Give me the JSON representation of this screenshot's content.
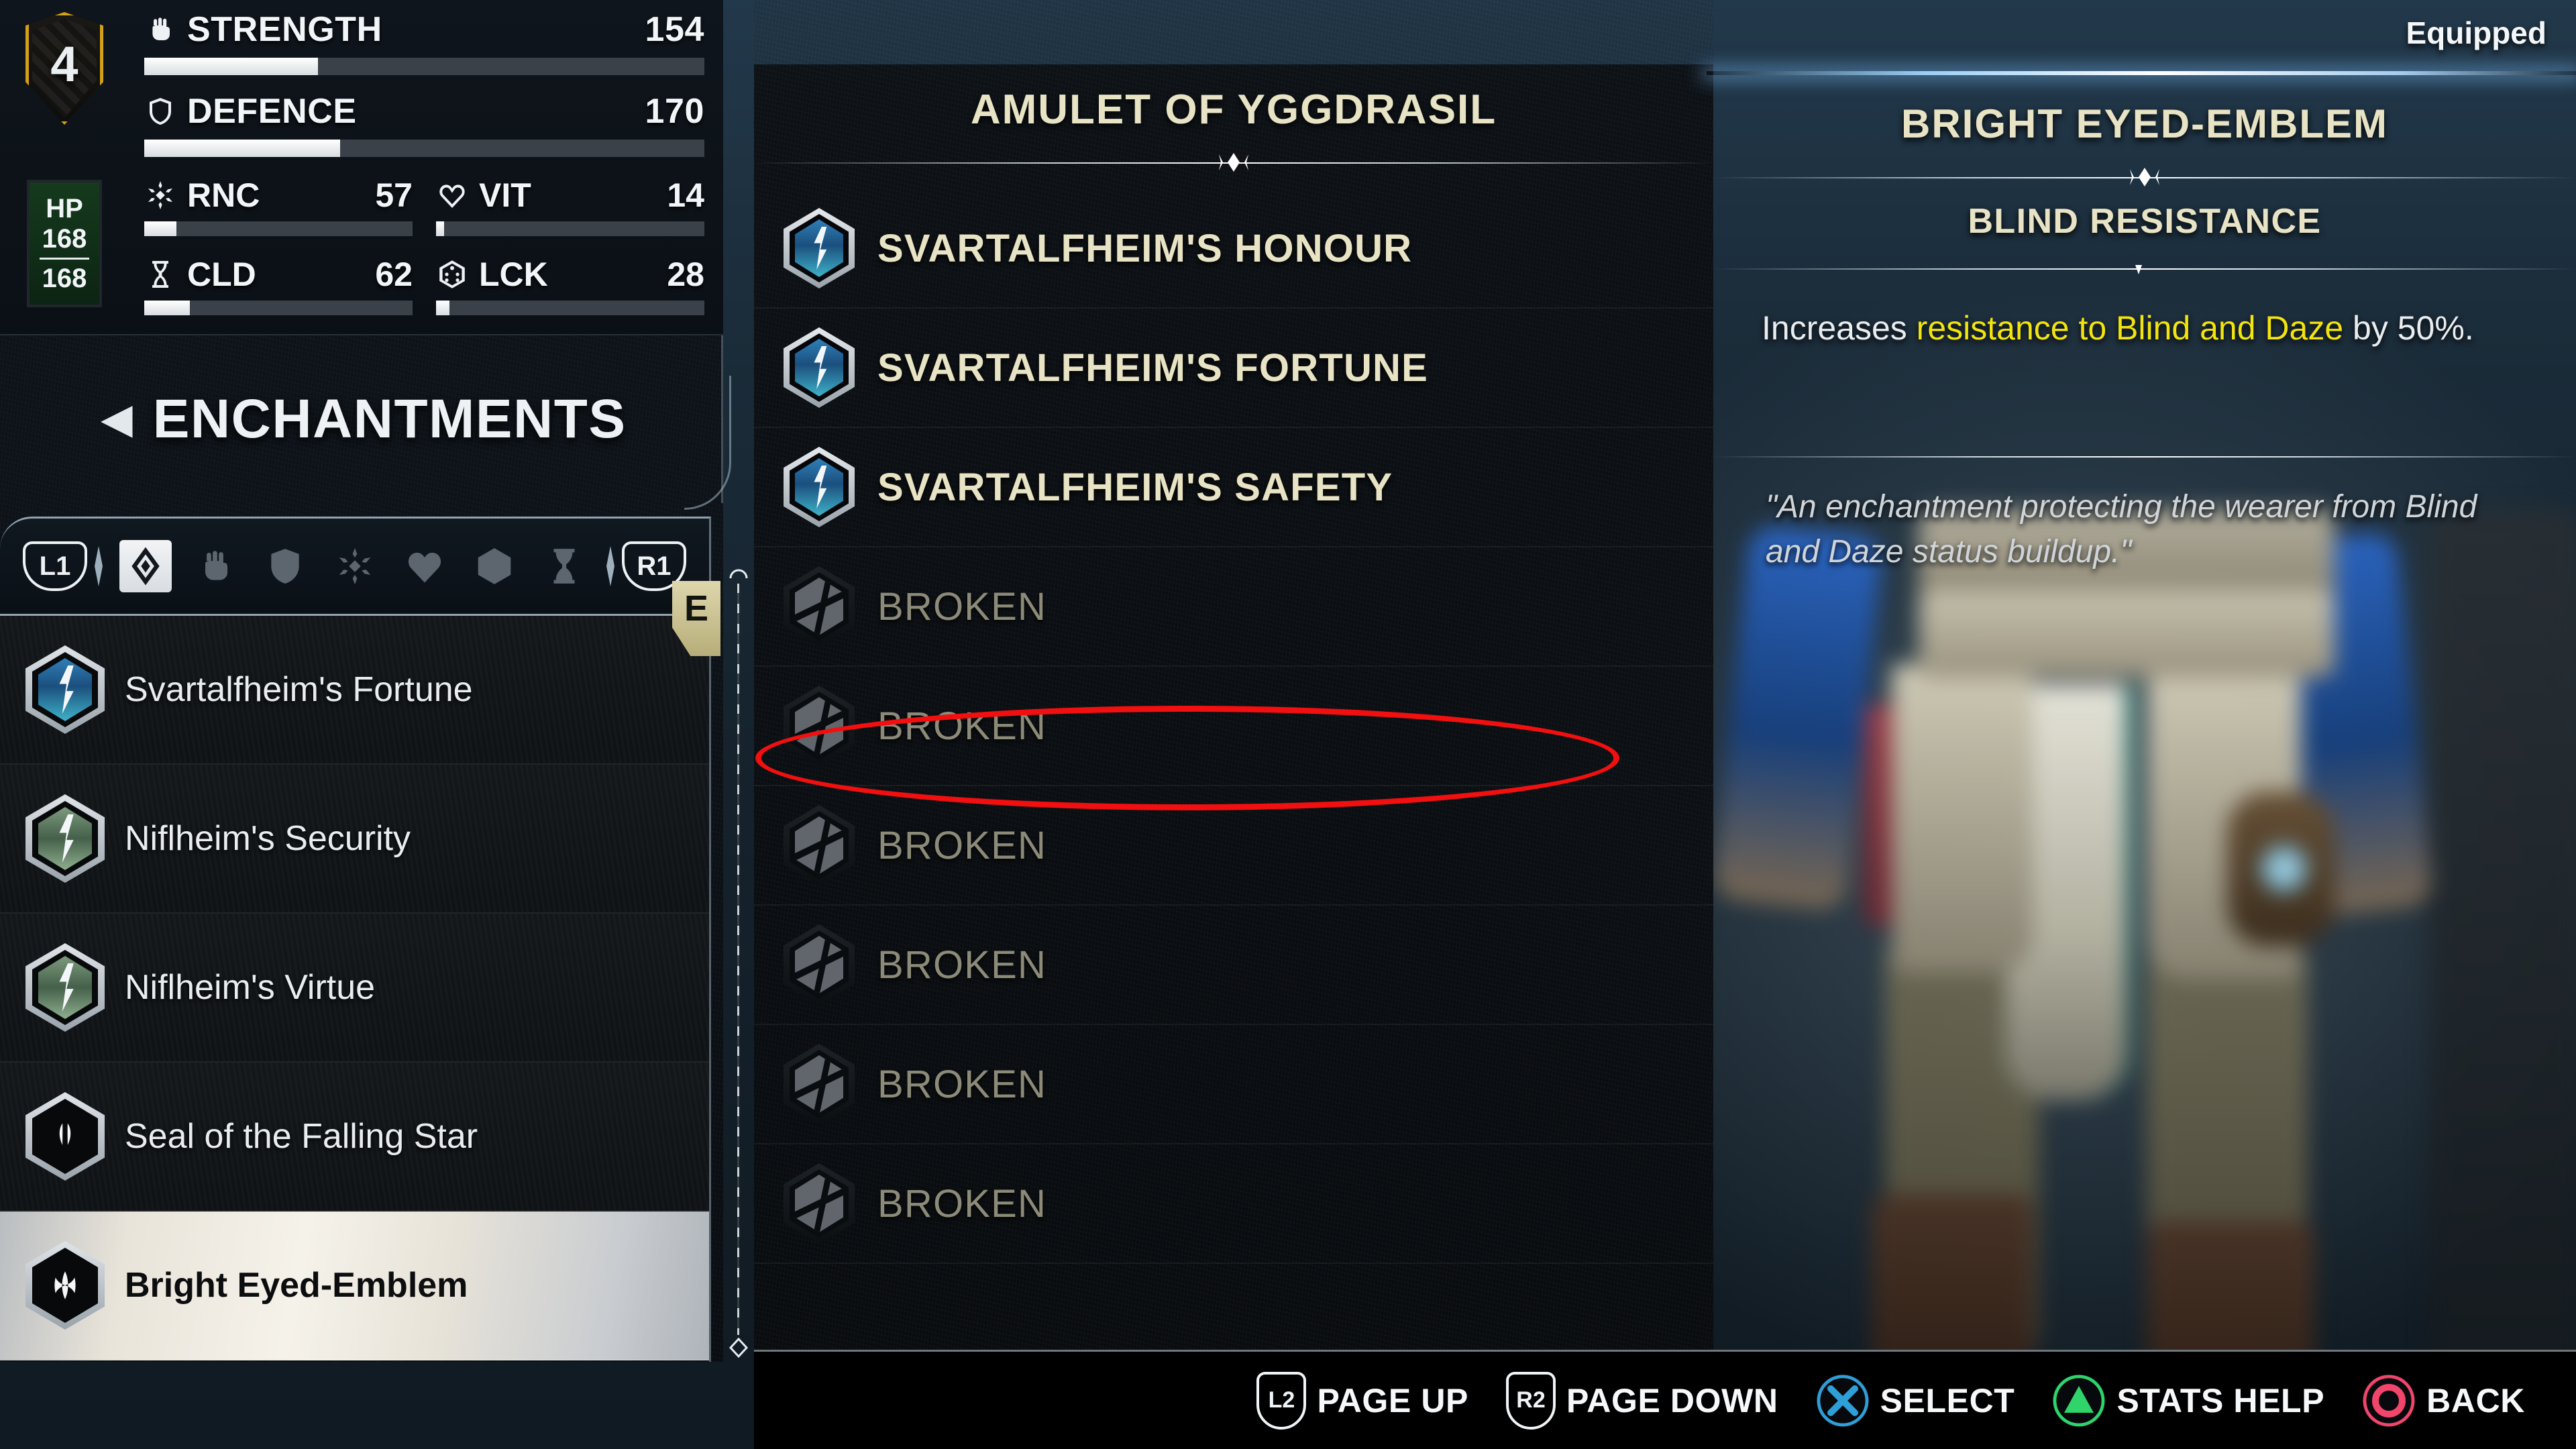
{
  "stats": {
    "level": "4",
    "hp": {
      "label": "HP",
      "current": "168",
      "max": "168"
    },
    "primary": [
      {
        "icon": "fist-icon",
        "name": "STRENGTH",
        "value": "154",
        "fill_pct": 31
      },
      {
        "icon": "shield-icon",
        "name": "DEFENCE",
        "value": "170",
        "fill_pct": 35
      }
    ],
    "secondary": [
      {
        "icon": "rune-icon",
        "name": "RNC",
        "value": "57",
        "fill_pct": 12
      },
      {
        "icon": "heart-icon",
        "name": "VIT",
        "value": "14",
        "fill_pct": 3
      },
      {
        "icon": "hourglass-icon",
        "name": "CLD",
        "value": "62",
        "fill_pct": 17
      },
      {
        "icon": "dice-icon",
        "name": "LCK",
        "value": "28",
        "fill_pct": 5
      }
    ]
  },
  "sidebar": {
    "header": {
      "back_arrow": "◀",
      "title": "ENCHANTMENTS"
    },
    "tabs": {
      "left_bumper": "L1",
      "right_bumper": "R1",
      "icons": [
        {
          "name": "diamond-icon",
          "selected": true
        },
        {
          "name": "fist-icon",
          "selected": false
        },
        {
          "name": "shield-icon",
          "selected": false
        },
        {
          "name": "rune-icon",
          "selected": false
        },
        {
          "name": "heart-icon",
          "selected": false
        },
        {
          "name": "dice-icon",
          "selected": false
        },
        {
          "name": "hourglass-icon",
          "selected": false
        }
      ]
    },
    "equipped_marker": "E",
    "items": [
      {
        "label": "Svartalfheim's Fortune",
        "icon": "rune-hex-blue",
        "selected": false
      },
      {
        "label": "Niflheim's Security",
        "icon": "rune-hex-green",
        "selected": false
      },
      {
        "label": "Niflheim's Virtue",
        "icon": "rune-hex-green",
        "selected": false
      },
      {
        "label": "Seal of the Falling Star",
        "icon": "seal-hex-white",
        "selected": false
      },
      {
        "label": "Bright Eyed-Emblem",
        "icon": "emblem-hex-white",
        "selected": true
      }
    ]
  },
  "center": {
    "title": "AMULET OF YGGDRASIL",
    "slots": [
      {
        "label": "SVARTALFHEIM'S HONOUR",
        "broken": false,
        "icon": "rune-hex-blue"
      },
      {
        "label": "SVARTALFHEIM'S FORTUNE",
        "broken": false,
        "icon": "rune-hex-blue"
      },
      {
        "label": "SVARTALFHEIM'S SAFETY",
        "broken": false,
        "icon": "rune-hex-blue"
      },
      {
        "label": "BROKEN",
        "broken": true,
        "icon": "broken-hex"
      },
      {
        "label": "BROKEN",
        "broken": true,
        "icon": "broken-hex"
      },
      {
        "label": "BROKEN",
        "broken": true,
        "icon": "broken-hex"
      },
      {
        "label": "BROKEN",
        "broken": true,
        "icon": "broken-hex"
      },
      {
        "label": "BROKEN",
        "broken": true,
        "icon": "broken-hex"
      },
      {
        "label": "BROKEN",
        "broken": true,
        "icon": "broken-hex"
      }
    ]
  },
  "detail": {
    "equipped_badge": "Equipped",
    "title": "BRIGHT EYED-EMBLEM",
    "subtitle": "BLIND RESISTANCE",
    "description_before": "Increases ",
    "description_highlight": "resistance to Blind and Daze",
    "description_after": " by 50%.",
    "flavor": "\"An enchantment protecting the wearer from Blind and Daze status buildup.\""
  },
  "prompts": [
    {
      "button": "L2",
      "type": "trigger",
      "label": "PAGE UP"
    },
    {
      "button": "R2",
      "type": "trigger",
      "label": "PAGE DOWN"
    },
    {
      "button": "cross-icon",
      "type": "pad",
      "label": "SELECT"
    },
    {
      "button": "triangle-icon",
      "type": "pad",
      "label": "STATS HELP"
    },
    {
      "button": "circle-icon",
      "type": "pad",
      "label": "BACK"
    }
  ],
  "colors": {
    "gold": "#d4a017",
    "bone": "#e7e3c4",
    "highlight_yellow": "#f2e40e",
    "hp_green": "#153a1d",
    "annotation_red": "#f10f0f",
    "cross_blue": "#2f9fd8",
    "triangle_green": "#2fd46a",
    "circle_red": "#f2456b"
  }
}
